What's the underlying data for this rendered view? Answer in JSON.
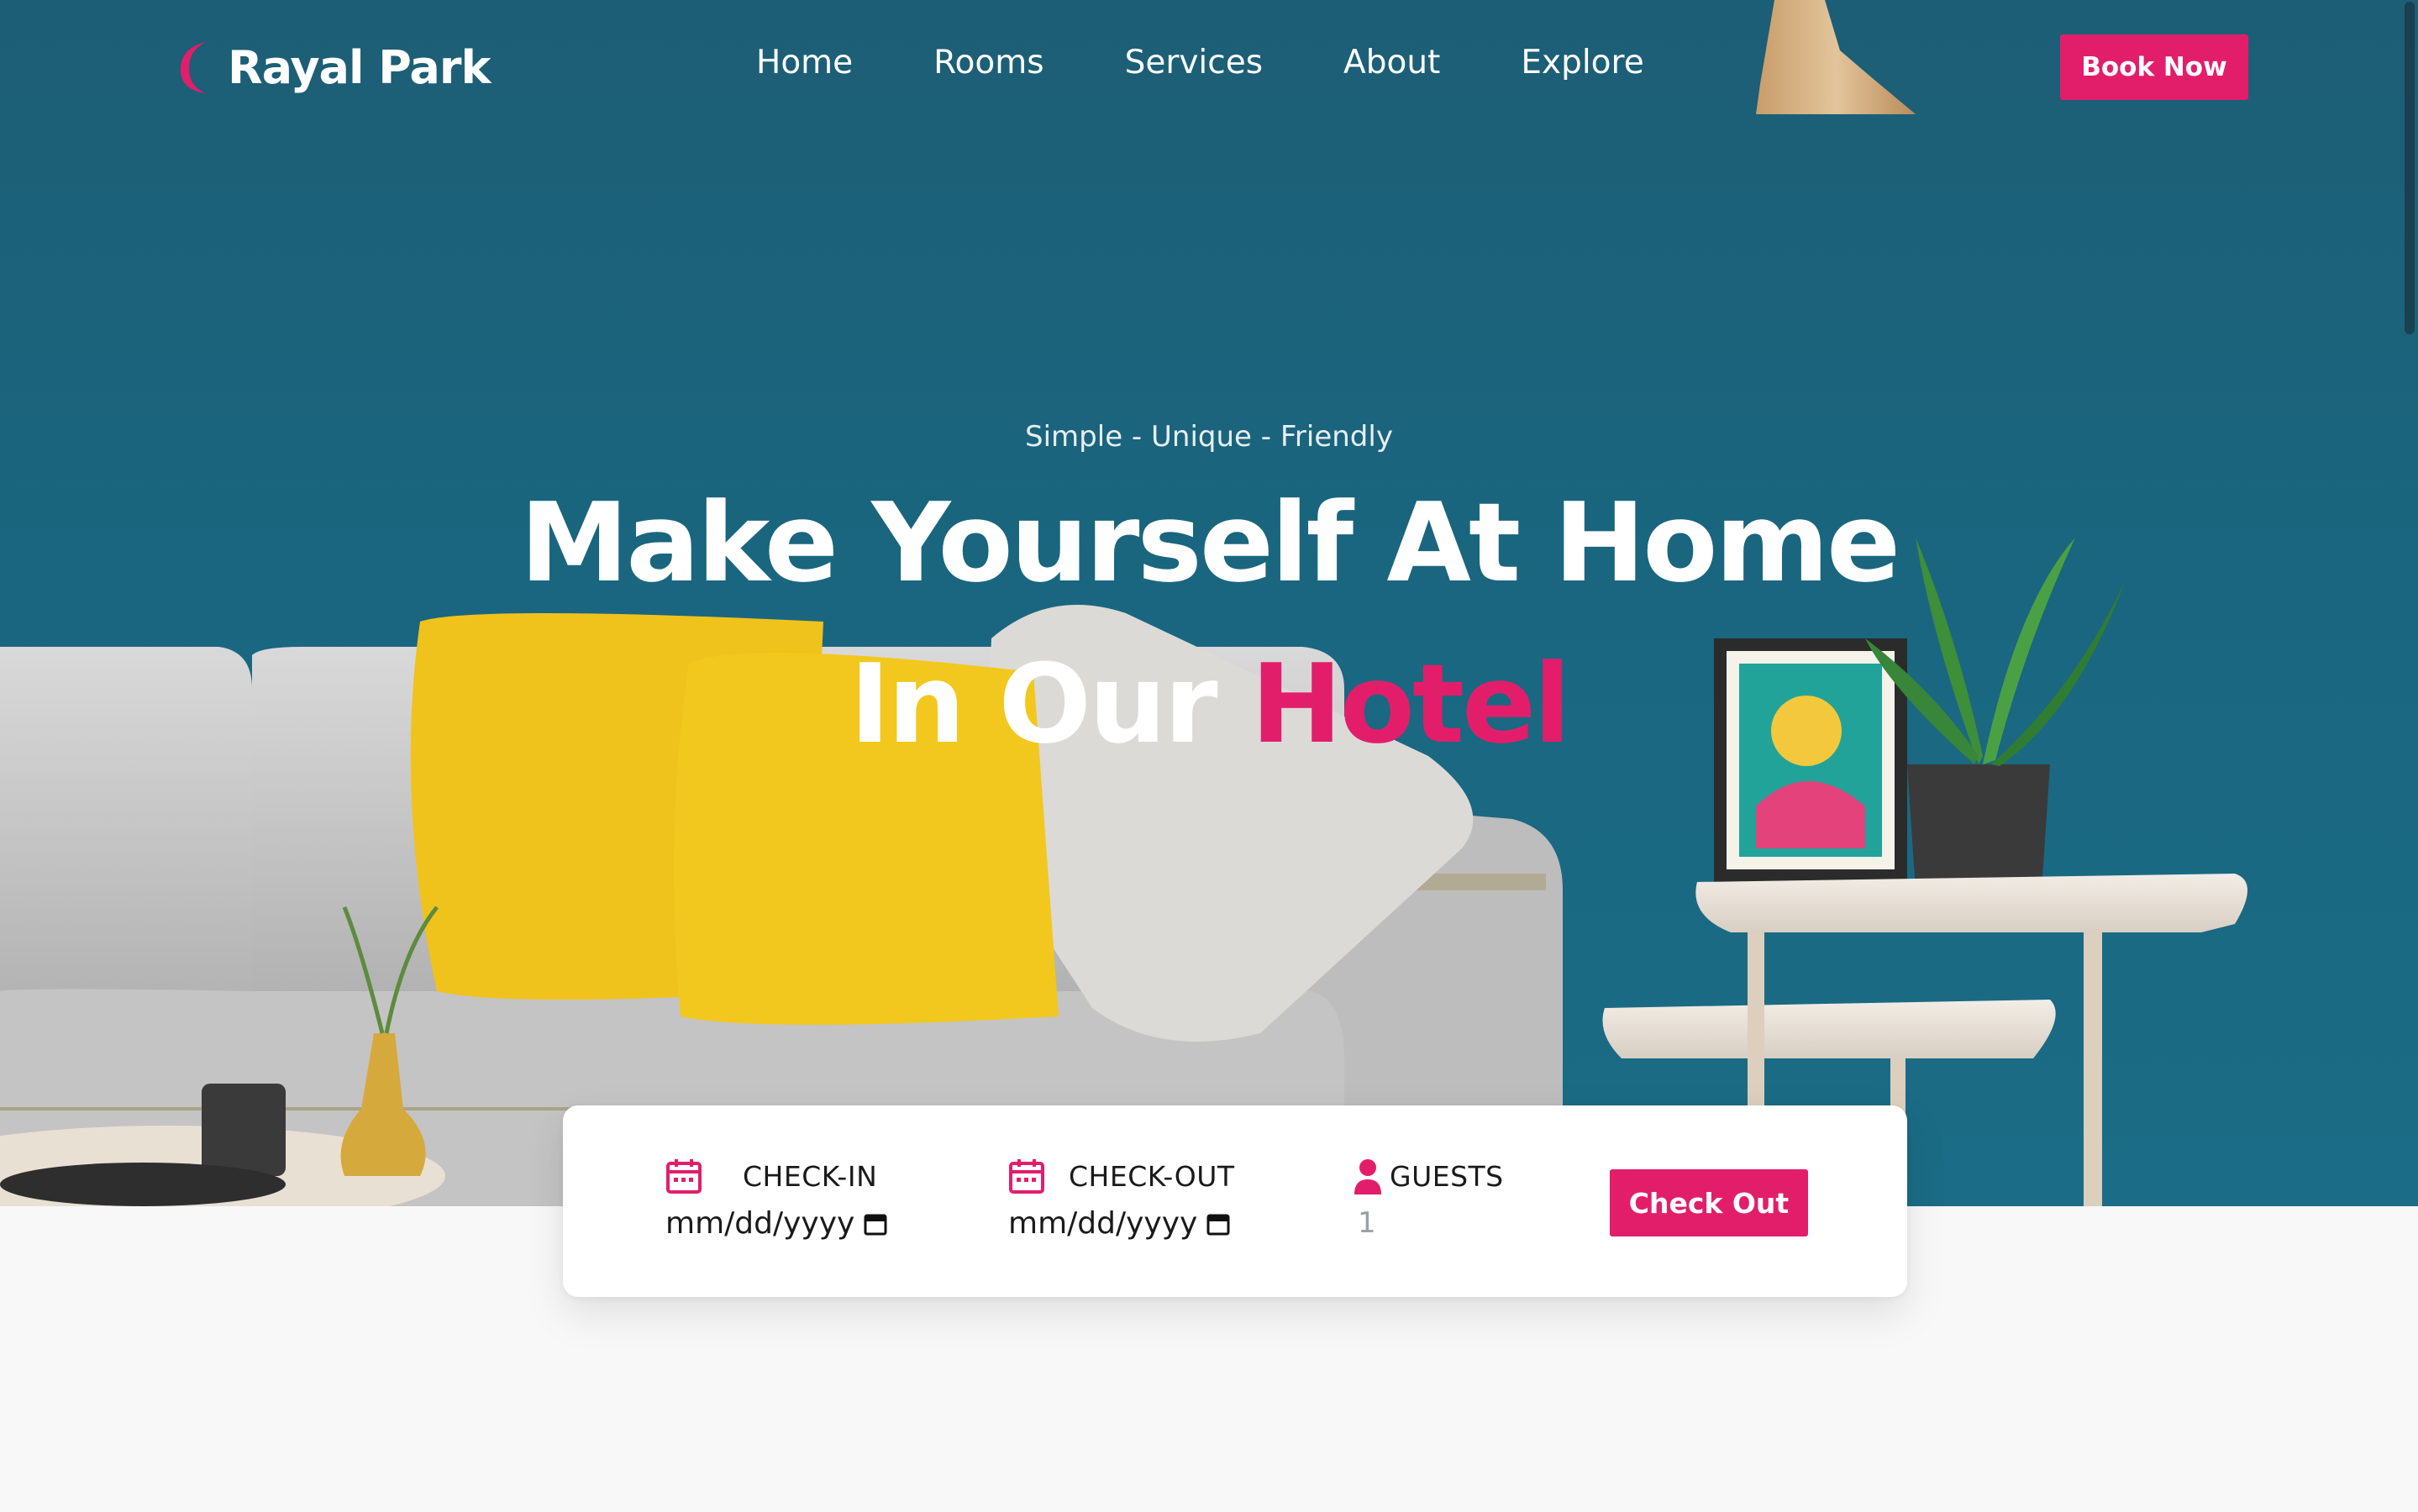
{
  "brand": {
    "name": "Rayal Park",
    "accent": "#e21e6b"
  },
  "nav": {
    "items": [
      {
        "label": "Home"
      },
      {
        "label": "Rooms"
      },
      {
        "label": "Services"
      },
      {
        "label": "About"
      },
      {
        "label": "Explore"
      }
    ],
    "book_label": "Book Now"
  },
  "hero": {
    "tagline": "Simple - Unique - Friendly",
    "line1": "Make Yourself At Home",
    "line2_prefix": "In Our ",
    "line2_accent": "Hotel"
  },
  "booking": {
    "checkin": {
      "label": "CHECK-IN",
      "placeholder": "mm/dd/yyyy",
      "icon": "calendar-icon"
    },
    "checkout": {
      "label": "CHECK-OUT",
      "placeholder": "mm/dd/yyyy",
      "icon": "calendar-icon"
    },
    "guests": {
      "label": "GUESTS",
      "value": "1",
      "icon": "user-icon"
    },
    "submit_label": "Check Out"
  },
  "colors": {
    "hero_wall": "#1b6c86",
    "pillow": "#f2c21a",
    "sofa": "#c9c9c9"
  }
}
